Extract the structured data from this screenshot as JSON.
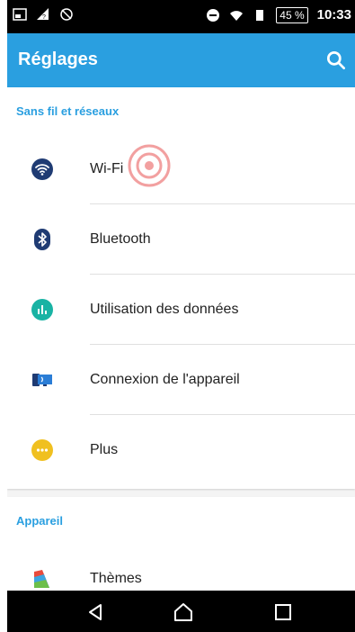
{
  "status_bar": {
    "battery": "45 %",
    "time": "10:33",
    "icons_left": [
      "screenshot-icon",
      "signal-icon",
      "data-off-icon"
    ],
    "icons_right": [
      "do-not-disturb-icon",
      "wifi-icon",
      "sim-icon"
    ]
  },
  "app_bar": {
    "title": "Réglages",
    "search_icon": "search-icon",
    "color": "#2a9fe0"
  },
  "sections": [
    {
      "header": "Sans fil et réseaux",
      "items": [
        {
          "label": "Wi-Fi",
          "icon": "wifi-icon",
          "icon_color": "#1f3b73"
        },
        {
          "label": "Bluetooth",
          "icon": "bluetooth-icon",
          "icon_color": "#1f3b73"
        },
        {
          "label": "Utilisation des données",
          "icon": "data-usage-icon",
          "icon_color": "#19b3a4"
        },
        {
          "label": "Connexion de l'appareil",
          "icon": "device-connection-icon",
          "icon_color": "#2a7dd6"
        },
        {
          "label": "Plus",
          "icon": "more-icon",
          "icon_color": "#f0c020"
        }
      ]
    },
    {
      "header": "Appareil",
      "items": [
        {
          "label": "Thèmes",
          "icon": "themes-icon"
        }
      ]
    }
  ],
  "nav_bar": {
    "back": "back-icon",
    "home": "home-icon",
    "recent": "recent-apps-icon"
  },
  "accent_colors": {
    "primary": "#2a9fe0",
    "touch_indicator": "#f2a0a0"
  }
}
